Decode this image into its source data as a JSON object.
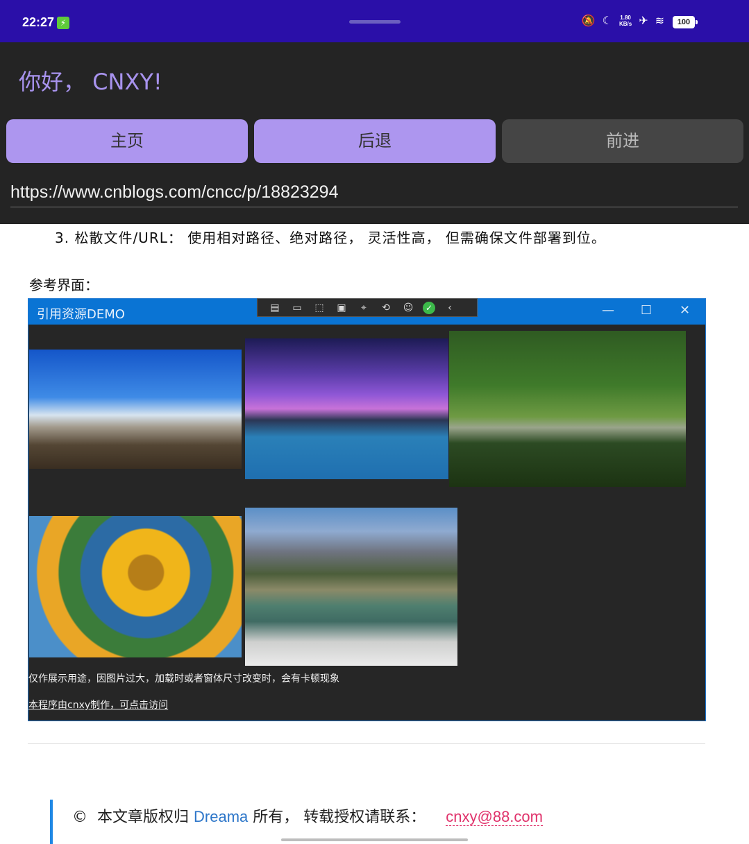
{
  "status_bar": {
    "time": "22:27",
    "net_speed": "1.80",
    "net_unit": "KB/s",
    "battery": "100"
  },
  "app": {
    "greeting": "你好， CNXY!",
    "nav": {
      "home": "主页",
      "back": "后退",
      "forward": "前进"
    },
    "url": "https://www.cnblogs.com/cncc/p/18823294"
  },
  "article": {
    "item3": "3. 松散文件/URL： 使用相对路径、绝对路径， 灵活性高， 但需确保文件部署到位。",
    "ref_header": "参考界面：",
    "demo_window": {
      "title": "引用资源DEMO",
      "caption": "仅作展示用途，因图片过大，加载时或者窗体尺寸改变时，会有卡顿现象",
      "link": "本程序由cnxy制作，可点击访问"
    },
    "copyright": {
      "prefix": "本文章版权归",
      "brand": "Dreama",
      "suffix": "所有， 转载授权请联系：",
      "email": "cnxy@88.com"
    }
  },
  "colors": {
    "status_bar": "#2a0fa8",
    "app_bg": "#242424",
    "accent": "#ad96ef",
    "window_title": "#0a74d4"
  }
}
